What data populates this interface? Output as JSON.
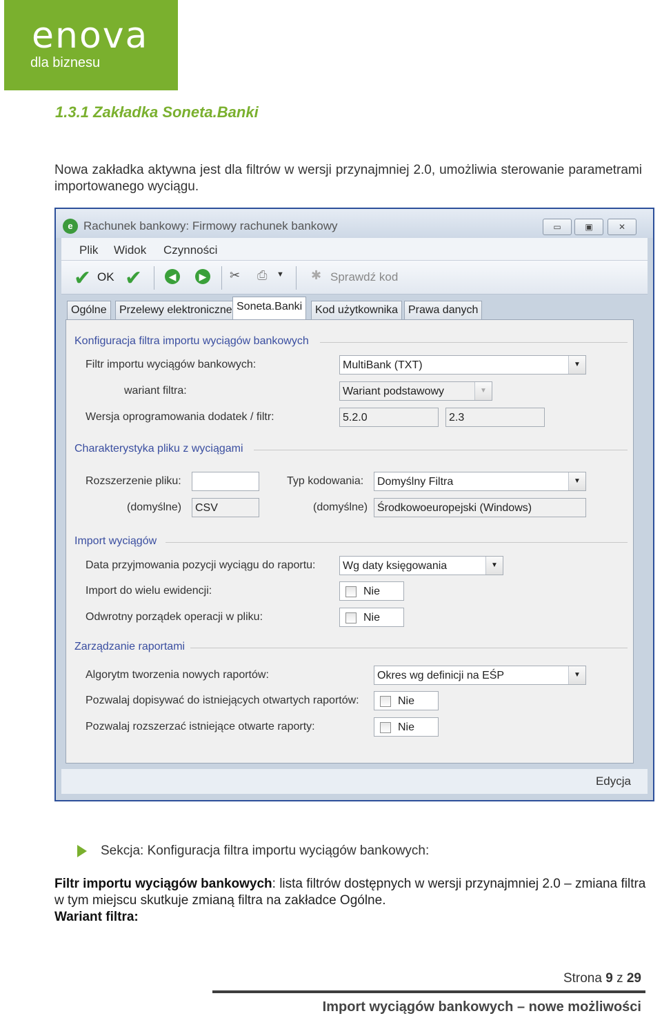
{
  "logo": {
    "brand": "enova",
    "tagline": "dla biznesu",
    "color": "#7ab02e"
  },
  "heading": "1.3.1  Zakładka Soneta.Banki",
  "intro": "Nowa zakładka aktywna jest dla filtrów w wersji przynajmniej 2.0, umożliwia sterowanie parametrami importowanego wyciągu.",
  "window": {
    "title": "Rachunek bankowy: Firmowy rachunek bankowy",
    "menu": [
      "Plik",
      "Widok",
      "Czynności"
    ],
    "toolbar": {
      "ok": "OK",
      "check_code": "Sprawdź kod"
    },
    "tabs": [
      "Ogólne",
      "Przelewy elektroniczne",
      "Soneta.Banki",
      "Kod użytkownika",
      "Prawa danych"
    ],
    "active_tab": "Soneta.Banki",
    "sections": {
      "filter_config": {
        "title": "Konfiguracja filtra importu wyciągów bankowych",
        "filter_label": "Filtr importu wyciągów bankowych:",
        "filter_value": "MultiBank (TXT)",
        "variant_label": "wariant filtra:",
        "variant_value": "Wariant podstawowy",
        "version_label": "Wersja oprogramowania dodatek / filtr:",
        "version_addon": "5.2.0",
        "version_filter": "2.3"
      },
      "file_char": {
        "title": "Charakterystyka pliku z wyciągami",
        "ext_label": "Rozszerzenie pliku:",
        "ext_value": "",
        "ext_default_label": "(domyślne)",
        "ext_default_value": "CSV",
        "enc_label": "Typ kodowania:",
        "enc_value": "Domyślny Filtra",
        "enc_default_label": "(domyślne)",
        "enc_default_value": "Środkowoeuropejski (Windows)"
      },
      "import": {
        "title": "Import wyciągów",
        "date_label": "Data przyjmowania pozycji wyciągu do raportu:",
        "date_value": "Wg daty księgowania",
        "multi_label": "Import do wielu ewidencji:",
        "multi_value": "Nie",
        "reverse_label": "Odwrotny porządek operacji w pliku:",
        "reverse_value": "Nie"
      },
      "reports": {
        "title": "Zarządzanie raportami",
        "algo_label": "Algorytm tworzenia nowych raportów:",
        "algo_value": "Okres wg definicji na EŚP",
        "append_label": "Pozwalaj dopisywać do istniejących otwartych raportów:",
        "append_value": "Nie",
        "extend_label": "Pozwalaj rozszerzać istniejące otwarte raporty:",
        "extend_value": "Nie"
      }
    },
    "status": "Edycja"
  },
  "bullet": "Sekcja: Konfiguracja filtra importu wyciągów bankowych:",
  "body": {
    "term1": "Filtr importu wyciągów bankowych",
    "desc1": ": lista filtrów dostępnych w wersji przynajmniej 2.0 – zmiana filtra w tym miejscu skutkuje zmianą filtra na zakładce Ogólne.",
    "term2": "Wariant filtra:"
  },
  "footer": {
    "page_label": "Strona",
    "page": "9",
    "of_label": "z",
    "total": "29",
    "title": "Import wyciągów bankowych – nowe możliwości"
  }
}
